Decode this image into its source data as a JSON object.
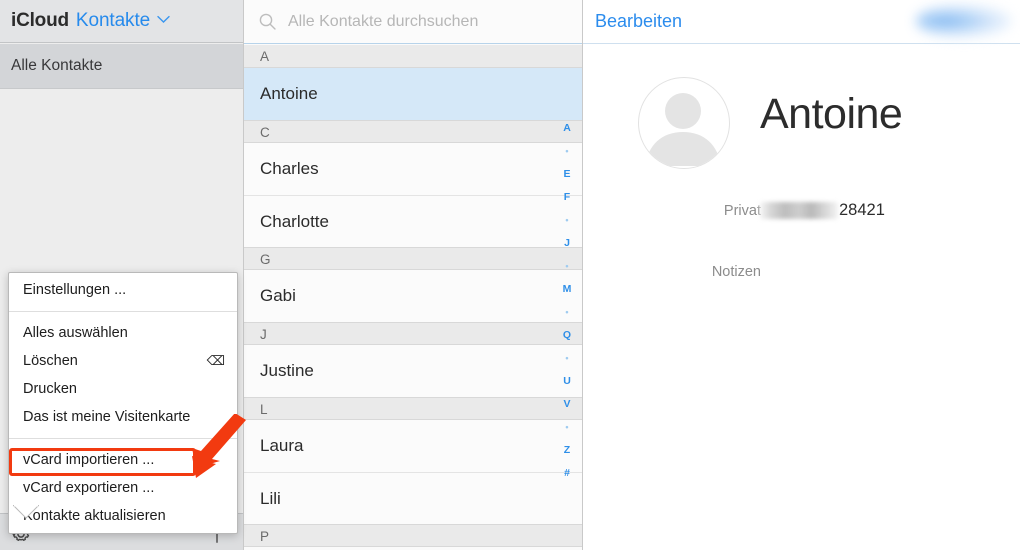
{
  "sidebar": {
    "brand": "iCloud",
    "app_name": "Kontakte",
    "chevron_icon": "chevron-down-icon",
    "all_contacts_label": "Alle Kontakte",
    "settings_icon": "gear-icon",
    "add_icon": "plus-icon"
  },
  "menu": {
    "groups": [
      {
        "items": [
          {
            "label": "Einstellungen ...",
            "accel": ""
          }
        ]
      },
      {
        "items": [
          {
            "label": "Alles auswählen",
            "accel": ""
          },
          {
            "label": "Löschen",
            "accel": "⌫"
          },
          {
            "label": "Drucken",
            "accel": ""
          },
          {
            "label": "Das ist meine Visitenkarte",
            "accel": ""
          }
        ]
      },
      {
        "items": [
          {
            "label": "vCard importieren ...",
            "accel": ""
          },
          {
            "label": "vCard exportieren ...",
            "accel": ""
          },
          {
            "label": "Kontakte aktualisieren",
            "accel": ""
          }
        ]
      }
    ],
    "highlight_label": "vCard exportieren ...",
    "highlight_color": "#f23a10",
    "annotation_arrow_color": "#f23a10"
  },
  "list": {
    "search": {
      "placeholder": "Alle Kontakte durchsuchen",
      "value": "",
      "icon": "search-icon"
    },
    "sections": [
      {
        "letter": "A",
        "contacts": [
          "Antoine"
        ]
      },
      {
        "letter": "C",
        "contacts": [
          "Charles",
          "Charlotte"
        ]
      },
      {
        "letter": "G",
        "contacts": [
          "Gabi"
        ]
      },
      {
        "letter": "J",
        "contacts": [
          "Justine"
        ]
      },
      {
        "letter": "L",
        "contacts": [
          "Laura",
          "Lili"
        ]
      },
      {
        "letter": "P",
        "contacts": []
      }
    ],
    "selected_contact": "Antoine",
    "index_strip": [
      "A",
      "•",
      "E",
      "F",
      "•",
      "J",
      "•",
      "M",
      "•",
      "Q",
      "•",
      "U",
      "V",
      "•",
      "Z",
      "#"
    ],
    "index_color": "#2f8fe8",
    "selection_color": "#d5e8f8"
  },
  "detail": {
    "edit_label": "Bearbeiten",
    "account_badge": "",
    "avatar_icon": "person-placeholder-icon",
    "name": "Antoine",
    "fields": [
      {
        "label": "Privat",
        "value_redacted": true,
        "value_suffix": "28421"
      },
      {
        "label": "Notizen",
        "value_redacted": false,
        "value_suffix": ""
      }
    ]
  }
}
